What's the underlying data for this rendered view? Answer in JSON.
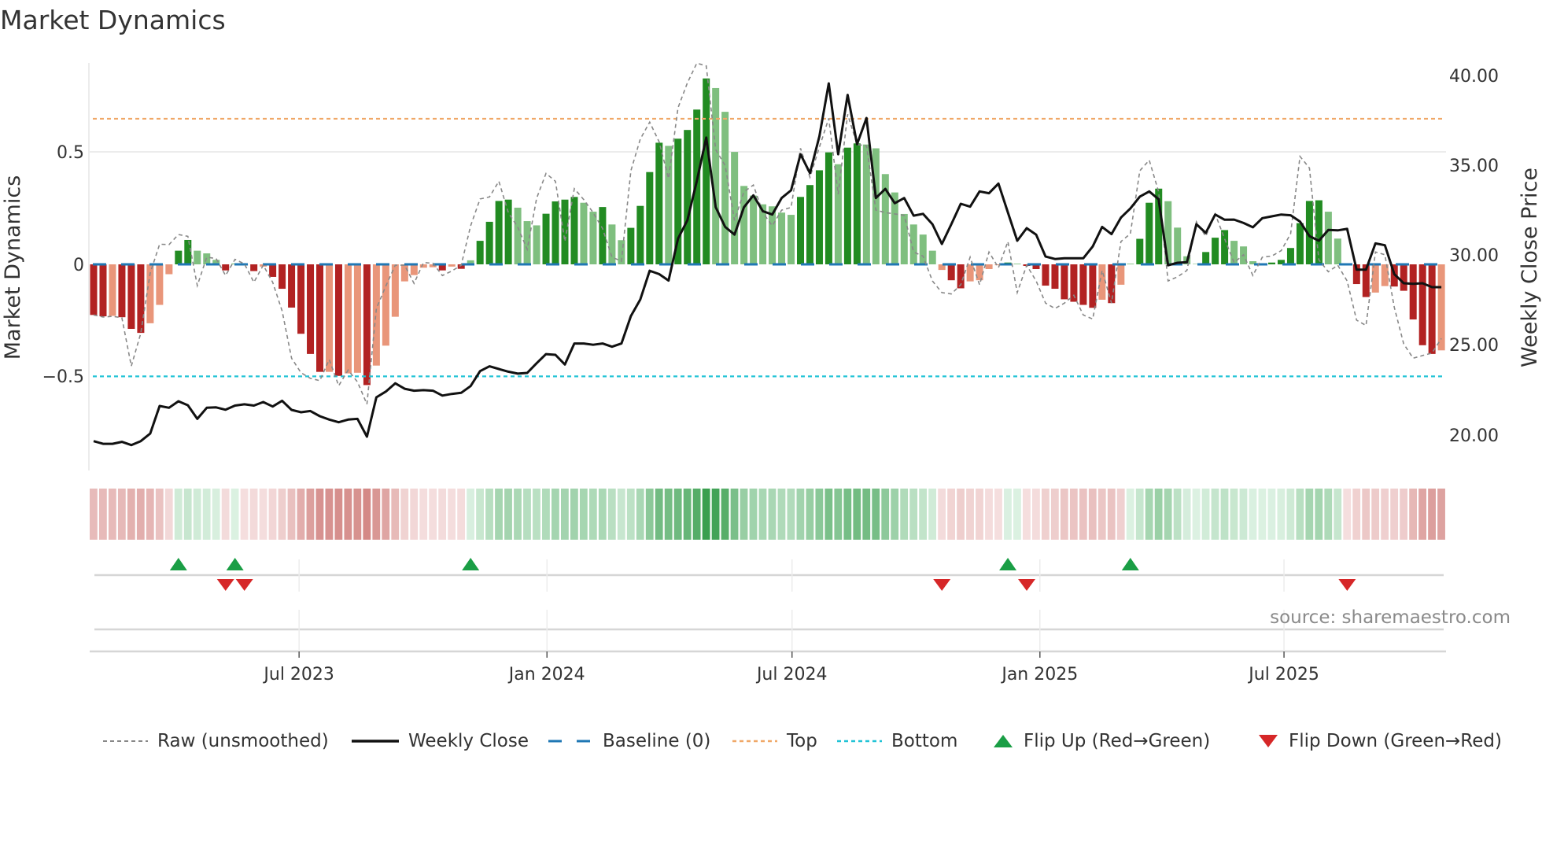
{
  "title": "Market Dynamics",
  "source": "source: sharemaestro.com",
  "colors": {
    "bar_up_strong": "#228b22",
    "bar_up_weak": "#7fbf7f",
    "bar_down_strong": "#b22222",
    "bar_down_weak": "#e9967a",
    "raw": "#888888",
    "close": "#111111",
    "baseline": "#1f77b4",
    "top": "#f0a868",
    "bottom": "#22c3d6",
    "flip_up": "#1a9e45",
    "flip_down": "#d62728"
  },
  "legend": [
    {
      "key": "raw",
      "label": "Raw (unsmoothed)"
    },
    {
      "key": "close",
      "label": "Weekly Close"
    },
    {
      "key": "baseline",
      "label": "Baseline (0)"
    },
    {
      "key": "top",
      "label": "Top"
    },
    {
      "key": "bottom",
      "label": "Bottom"
    },
    {
      "key": "flip_up",
      "label": "Flip Up (Red→Green)"
    },
    {
      "key": "flip_down",
      "label": "Flip Down (Green→Red)"
    }
  ],
  "chart_data": {
    "type": "bar",
    "title": "Market Dynamics",
    "ylabel": "Market Dynamics",
    "ylabel_right": "Weekly Close Price",
    "ylim": [
      -0.88,
      0.9
    ],
    "ylim_right": [
      18.8,
      40.6
    ],
    "yticks": [
      {
        "value": 0.5,
        "label": "0.5"
      },
      {
        "value": 0,
        "label": "0"
      },
      {
        "value": -0.5,
        "label": "−0.5"
      }
    ],
    "yticks_right": [
      {
        "value": 40,
        "label": "40.00"
      },
      {
        "value": 35,
        "label": "35.00"
      },
      {
        "value": 30,
        "label": "30.00"
      },
      {
        "value": 25,
        "label": "25.00"
      },
      {
        "value": 20,
        "label": "20.00"
      }
    ],
    "xticks": [
      {
        "label": "Jul 2023",
        "week_index": 21.8
      },
      {
        "label": "Jan 2024",
        "week_index": 48.1
      },
      {
        "label": "Jul 2024",
        "week_index": 74.1
      },
      {
        "label": "Jan 2025",
        "week_index": 100.4
      },
      {
        "label": "Jul 2025",
        "week_index": 126.3
      }
    ],
    "baseline": 0,
    "top": 0.65,
    "bottom": -0.5,
    "grid": true,
    "legend_position": "bottom",
    "series": [
      {
        "name": "Market Dynamics (smoothed)",
        "values": [
          -0.226,
          -0.232,
          -0.23,
          -0.236,
          -0.288,
          -0.306,
          -0.263,
          -0.181,
          -0.044,
          0.061,
          0.109,
          0.061,
          0.049,
          0.02,
          -0.027,
          0.004,
          -0.004,
          -0.03,
          -0.01,
          -0.056,
          -0.109,
          -0.193,
          -0.31,
          -0.4,
          -0.48,
          -0.48,
          -0.498,
          -0.487,
          -0.484,
          -0.539,
          -0.452,
          -0.363,
          -0.234,
          -0.076,
          -0.048,
          -0.015,
          -0.013,
          -0.027,
          -0.01,
          -0.02,
          0.018,
          0.105,
          0.19,
          0.283,
          0.289,
          0.253,
          0.193,
          0.174,
          0.226,
          0.281,
          0.289,
          0.301,
          0.275,
          0.235,
          0.256,
          0.178,
          0.108,
          0.163,
          0.261,
          0.412,
          0.543,
          0.529,
          0.561,
          0.6,
          0.691,
          0.83,
          0.787,
          0.681,
          0.502,
          0.35,
          0.307,
          0.268,
          0.259,
          0.231,
          0.221,
          0.301,
          0.354,
          0.42,
          0.5,
          0.447,
          0.521,
          0.54,
          0.535,
          0.518,
          0.403,
          0.321,
          0.225,
          0.178,
          0.133,
          0.061,
          -0.025,
          -0.071,
          -0.107,
          -0.076,
          -0.071,
          -0.021,
          -0.004,
          0.008,
          0.003,
          -0.007,
          -0.021,
          -0.095,
          -0.109,
          -0.156,
          -0.167,
          -0.181,
          -0.194,
          -0.158,
          -0.173,
          -0.091,
          0.003,
          0.114,
          0.275,
          0.338,
          0.282,
          0.164,
          0.036,
          0.002,
          0.055,
          0.119,
          0.153,
          0.105,
          0.08,
          0.014,
          0.003,
          0.008,
          0.02,
          0.073,
          0.184,
          0.283,
          0.286,
          0.235,
          0.115,
          -0.005,
          -0.088,
          -0.146,
          -0.126,
          -0.097,
          -0.099,
          -0.118,
          -0.246,
          -0.361,
          -0.4,
          -0.384
        ]
      },
      {
        "name": "Raw (unsmoothed)",
        "values": [
          -0.226,
          -0.235,
          -0.232,
          -0.238,
          -0.454,
          -0.308,
          -0.039,
          0.09,
          0.088,
          0.133,
          0.125,
          -0.095,
          0.032,
          0.026,
          -0.05,
          0.022,
          0.002,
          -0.08,
          -0.004,
          -0.08,
          -0.208,
          -0.419,
          -0.484,
          -0.509,
          -0.519,
          -0.425,
          -0.542,
          -0.472,
          -0.525,
          -0.624,
          -0.197,
          -0.097,
          -0.004,
          -0.004,
          -0.085,
          0.008,
          0.005,
          -0.05,
          -0.03,
          -0.004,
          0.172,
          0.292,
          0.301,
          0.371,
          0.231,
          0.166,
          0.067,
          0.295,
          0.406,
          0.371,
          0.102,
          0.338,
          0.289,
          0.231,
          0.16,
          0.032,
          0.014,
          0.418,
          0.559,
          0.635,
          0.547,
          0.383,
          0.699,
          0.81,
          0.898,
          0.886,
          0.512,
          0.441,
          0.196,
          0.324,
          0.354,
          0.231,
          0.172,
          0.242,
          0.254,
          0.518,
          0.389,
          0.523,
          0.652,
          0.313,
          0.67,
          0.535,
          0.529,
          0.242,
          0.231,
          0.225,
          0.219,
          0.055,
          0.037,
          -0.074,
          -0.126,
          -0.132,
          -0.091,
          0.032,
          -0.091,
          0.055,
          -0.015,
          0.102,
          -0.126,
          -0.004,
          -0.074,
          -0.173,
          -0.197,
          -0.173,
          -0.138,
          -0.226,
          -0.244,
          -0.027,
          -0.173,
          0.102,
          0.137,
          0.418,
          0.465,
          0.324,
          -0.074,
          -0.056,
          -0.027,
          0.19,
          0.125,
          0.225,
          0.114,
          0.008,
          0.043,
          -0.05,
          0.032,
          0.037,
          0.061,
          0.137,
          0.482,
          0.43,
          0.02,
          -0.033,
          -0.004,
          -0.074,
          -0.249,
          -0.273,
          0.055,
          0.043,
          -0.191,
          -0.355,
          -0.419,
          -0.407,
          -0.396,
          -0.331
        ]
      },
      {
        "name": "Weekly Close",
        "axis": "right",
        "values": [
          19.62,
          19.47,
          19.47,
          19.58,
          19.4,
          19.62,
          20.04,
          21.58,
          21.48,
          21.84,
          21.62,
          20.86,
          21.48,
          21.5,
          21.37,
          21.6,
          21.67,
          21.6,
          21.8,
          21.55,
          21.87,
          21.36,
          21.23,
          21.3,
          21.01,
          20.82,
          20.67,
          20.82,
          20.86,
          19.87,
          22.06,
          22.38,
          22.84,
          22.54,
          22.43,
          22.46,
          22.43,
          22.16,
          22.25,
          22.31,
          22.69,
          23.52,
          23.79,
          23.64,
          23.49,
          23.38,
          23.42,
          23.96,
          24.47,
          24.43,
          23.89,
          25.06,
          25.06,
          24.99,
          25.06,
          24.88,
          25.06,
          26.59,
          27.51,
          29.12,
          28.93,
          28.57,
          30.91,
          31.93,
          34.12,
          36.54,
          32.66,
          31.56,
          31.13,
          32.66,
          33.32,
          32.44,
          32.25,
          33.17,
          33.6,
          35.61,
          34.56,
          36.61,
          39.56,
          35.61,
          38.92,
          36.17,
          37.63,
          33.17,
          33.68,
          32.88,
          33.17,
          32.19,
          32.29,
          31.71,
          30.61,
          31.71,
          32.85,
          32.69,
          33.54,
          33.44,
          33.98,
          32.37,
          30.79,
          31.49,
          31.13,
          29.91,
          29.77,
          29.81,
          29.81,
          29.81,
          30.47,
          31.56,
          31.16,
          32.08,
          32.59,
          33.25,
          33.54,
          33.1,
          29.42,
          29.56,
          29.59,
          31.71,
          31.23,
          32.25,
          31.96,
          31.97,
          31.78,
          31.54,
          32.05,
          32.15,
          32.25,
          32.21,
          31.86,
          31.05,
          30.79,
          31.39,
          31.37,
          31.45,
          29.18,
          29.18,
          30.64,
          30.54,
          28.93,
          28.42,
          28.39,
          28.42,
          28.2,
          28.2
        ]
      }
    ],
    "flips_up_week_index": [
      9,
      15,
      40,
      97,
      110
    ],
    "flips_down_week_index": [
      14,
      16,
      90,
      99,
      133
    ]
  }
}
